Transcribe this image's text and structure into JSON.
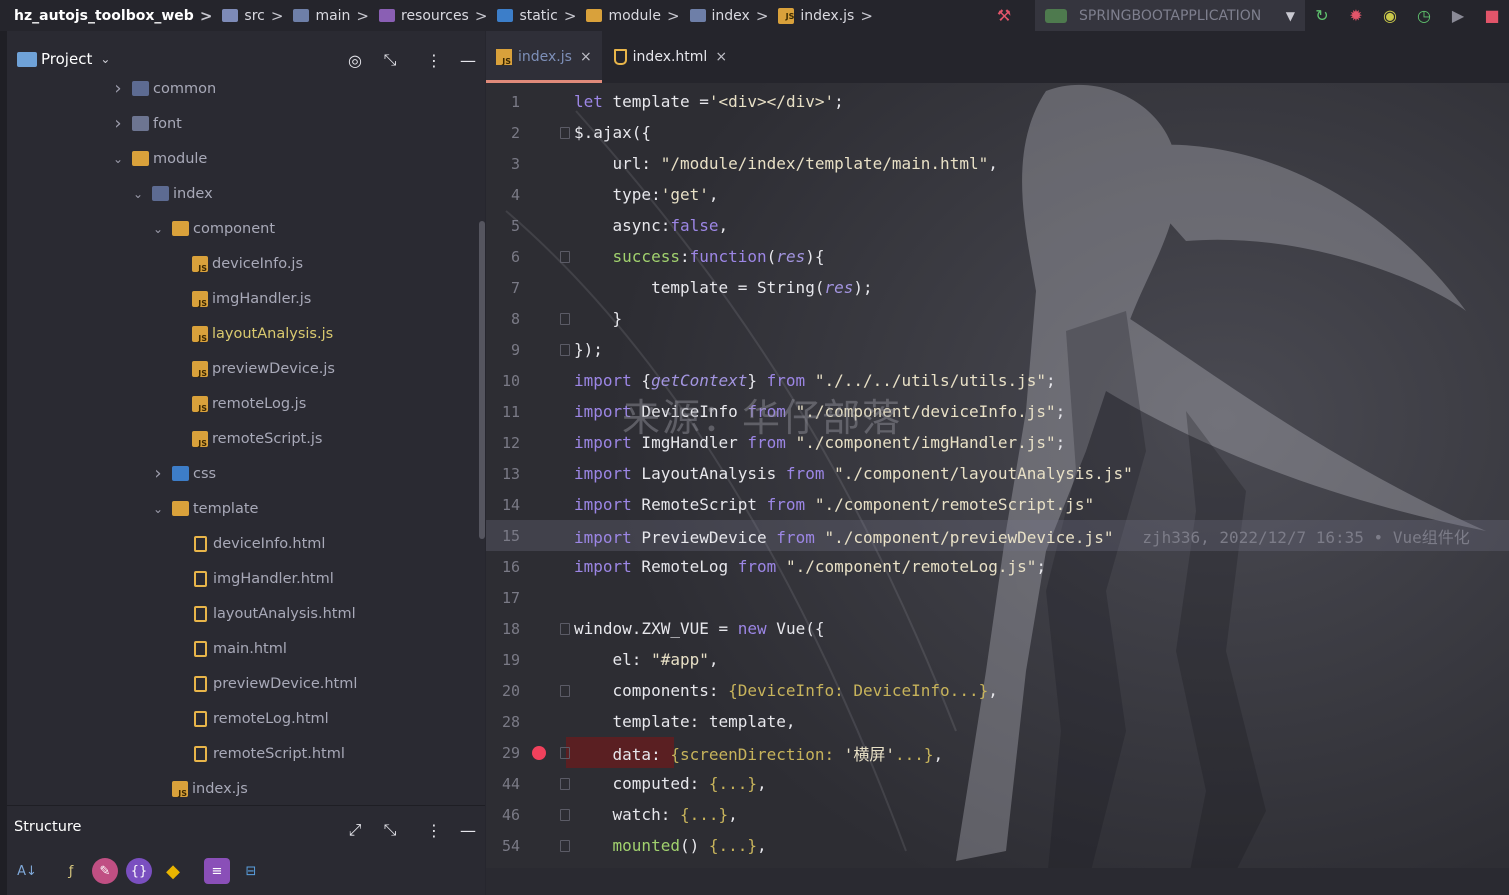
{
  "breadcrumbs": [
    {
      "label": "hz_autojs_toolbox_web",
      "icon": "project",
      "bold": true
    },
    {
      "label": "src",
      "icon": "source-folder-icon"
    },
    {
      "label": "main",
      "icon": "folder-icon"
    },
    {
      "label": "resources",
      "icon": "resources-folder-icon"
    },
    {
      "label": "static",
      "icon": "web-folder-icon"
    },
    {
      "label": "module",
      "icon": "module-folder-icon"
    },
    {
      "label": "index",
      "icon": "folder-icon"
    },
    {
      "label": "index.js",
      "icon": "js-file-icon"
    }
  ],
  "run_config": {
    "label": "SPRINGBOOTAPPLICATION"
  },
  "project_panel": {
    "title": "Project"
  },
  "tree": [
    {
      "label": "common",
      "depth": 1,
      "arrow": ">",
      "icon": "folder"
    },
    {
      "label": "font",
      "depth": 1,
      "arrow": ">",
      "icon": "font"
    },
    {
      "label": "module",
      "depth": 1,
      "arrow": "v",
      "icon": "mod"
    },
    {
      "label": "index",
      "depth": 2,
      "arrow": "v",
      "icon": "folder"
    },
    {
      "label": "component",
      "depth": 3,
      "arrow": "v",
      "icon": "mod"
    },
    {
      "label": "deviceInfo.js",
      "depth": 4,
      "arrow": "",
      "icon": "js"
    },
    {
      "label": "imgHandler.js",
      "depth": 4,
      "arrow": "",
      "icon": "js"
    },
    {
      "label": "layoutAnalysis.js",
      "depth": 4,
      "arrow": "",
      "icon": "js",
      "highlight": true
    },
    {
      "label": "previewDevice.js",
      "depth": 4,
      "arrow": "",
      "icon": "js"
    },
    {
      "label": "remoteLog.js",
      "depth": 4,
      "arrow": "",
      "icon": "js"
    },
    {
      "label": "remoteScript.js",
      "depth": 4,
      "arrow": "",
      "icon": "js"
    },
    {
      "label": "css",
      "depth": 3,
      "arrow": ">",
      "icon": "css"
    },
    {
      "label": "template",
      "depth": 3,
      "arrow": "v",
      "icon": "mod"
    },
    {
      "label": "deviceInfo.html",
      "depth": 4,
      "arrow": "",
      "icon": "html"
    },
    {
      "label": "imgHandler.html",
      "depth": 4,
      "arrow": "",
      "icon": "html"
    },
    {
      "label": "layoutAnalysis.html",
      "depth": 4,
      "arrow": "",
      "icon": "html"
    },
    {
      "label": "main.html",
      "depth": 4,
      "arrow": "",
      "icon": "html"
    },
    {
      "label": "previewDevice.html",
      "depth": 4,
      "arrow": "",
      "icon": "html"
    },
    {
      "label": "remoteLog.html",
      "depth": 4,
      "arrow": "",
      "icon": "html"
    },
    {
      "label": "remoteScript.html",
      "depth": 4,
      "arrow": "",
      "icon": "html"
    },
    {
      "label": "index.js",
      "depth": 3,
      "arrow": "",
      "icon": "js"
    }
  ],
  "structure_panel": {
    "title": "Structure"
  },
  "tabs": [
    {
      "label": "index.js",
      "active": true,
      "icon": "js"
    },
    {
      "label": "index.html",
      "active": false,
      "icon": "html"
    }
  ],
  "code_lines": [
    {
      "num": "1",
      "html": "<span class='k'>let</span> template =<span class='s'>'&lt;div&gt;&lt;/div&gt;'</span>;"
    },
    {
      "num": "2",
      "html": "$.ajax({",
      "fold": true
    },
    {
      "num": "3",
      "html": "    url: <span class='s'>\"/module/index/template/main.html\"</span>,"
    },
    {
      "num": "4",
      "html": "    type:<span class='s'>'get'</span>,"
    },
    {
      "num": "5",
      "html": "    async:<span class='k'>false</span>,"
    },
    {
      "num": "6",
      "html": "    <span class='g'>success</span>:<span class='k'>function</span>(<span class='it'>res</span>){",
      "fold": true
    },
    {
      "num": "7",
      "html": "        template = String(<span class='it'>res</span>);"
    },
    {
      "num": "8",
      "html": "    }",
      "fold": true
    },
    {
      "num": "9",
      "html": "});",
      "fold": true
    },
    {
      "num": "10",
      "html": "<span class='k'>import</span> {<span class='it'>getContext</span>} <span class='k'>from</span> <span class='s'>\"./../../utils/utils.js\"</span>;"
    },
    {
      "num": "11",
      "html": "<span class='k'>import</span> DeviceInfo <span class='k'>from</span> <span class='s'>\"./component/deviceInfo.js\"</span>;"
    },
    {
      "num": "12",
      "html": "<span class='k'>import</span> ImgHandler <span class='k'>from</span> <span class='s'>\"./component/imgHandler.js\"</span>;"
    },
    {
      "num": "13",
      "html": "<span class='k'>import</span> LayoutAnalysis <span class='k'>from</span> <span class='s'>\"./component/layoutAnalysis.js\"</span>"
    },
    {
      "num": "14",
      "html": "<span class='k'>import</span> RemoteScript <span class='k'>from</span> <span class='s'>\"./component/remoteScript.js\"</span>"
    },
    {
      "num": "15",
      "html": "<span class='k'>import</span> PreviewDevice <span class='k'>from</span> <span class='s'>\"./component/previewDevice.js\"</span>   <span class='blame'>zjh336, 2022/12/7 16:35 • Vue组件化</span>",
      "current": true
    },
    {
      "num": "16",
      "html": "<span class='k'>import</span> RemoteLog <span class='k'>from</span> <span class='s'>\"./component/remoteLog.js\"</span>;"
    },
    {
      "num": "17",
      "html": ""
    },
    {
      "num": "18",
      "html": "window.ZXW_VUE = <span class='k'>new</span> Vue({",
      "fold": true
    },
    {
      "num": "19",
      "html": "    el: <span class='s'>\"#app\"</span>,"
    },
    {
      "num": "20",
      "html": "    components: <span class='y'>{DeviceInfo: DeviceInfo...}</span>,",
      "fold": true
    },
    {
      "num": "28",
      "html": "    template: template,"
    },
    {
      "num": "29",
      "html": "    data: <span class='y'>{screenDirection: </span><span class='s'>'横屏'</span><span class='y'>...}</span>,",
      "fold": true,
      "breakpoint": true
    },
    {
      "num": "44",
      "html": "    computed: <span class='y'>{...}</span>,",
      "fold": true
    },
    {
      "num": "46",
      "html": "    watch: <span class='y'>{...}</span>,",
      "fold": true
    },
    {
      "num": "54",
      "html": "    <span class='g'>mounted</span>() <span class='y'>{...}</span>,",
      "fold": true
    }
  ],
  "watermark": "来源：华仔部落"
}
